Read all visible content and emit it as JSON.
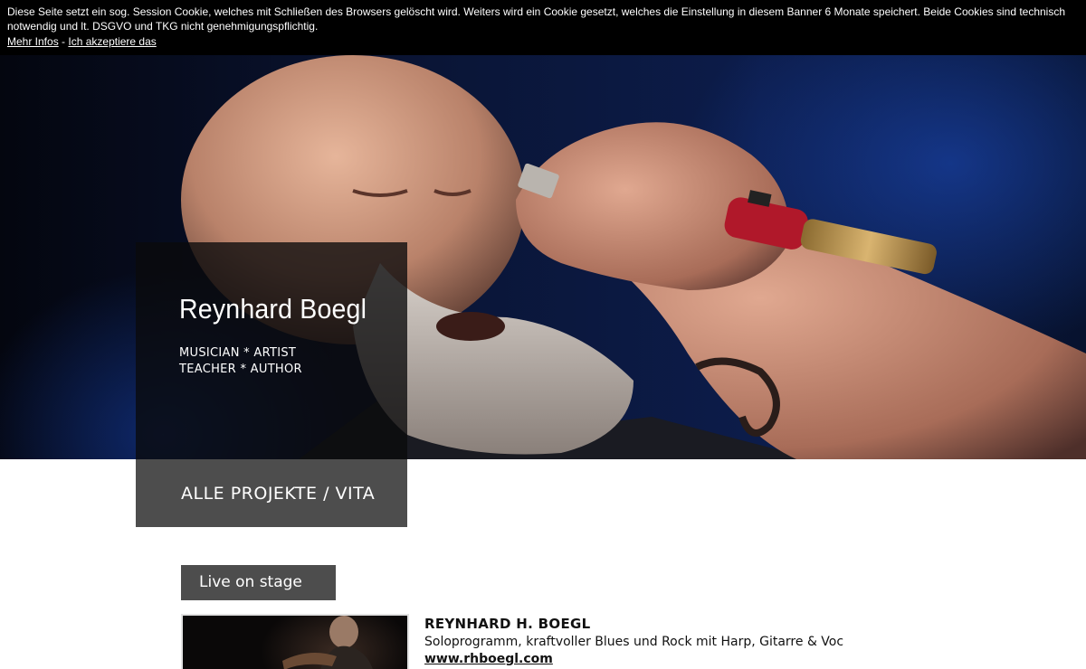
{
  "cookie_banner": {
    "text": "Diese Seite setzt ein sog. Session Cookie, welches mit Schließen des Browsers gelöscht wird. Weiters wird ein Cookie gesetzt, welches die Einstellung in diesem Banner 6 Monate speichert. Beide Cookies sind technisch notwendig und lt. DSGVO und TKG nicht genehmigungspflichtig.",
    "more_info_label": "Mehr Infos",
    "separator": "-",
    "accept_label": "Ich akzeptiere das"
  },
  "hero": {
    "name": "Reynhard Boegl",
    "tagline_line1": "MUSICIAN * ARTIST",
    "tagline_line2": "TEACHER * AUTHOR",
    "projects_button_label": "ALLE PROJEKTE / VITA"
  },
  "section": {
    "live_button_label": "Live on stage"
  },
  "entry": {
    "title": "REYNHARD H. BOEGL",
    "description": "Soloprogramm, kraftvoller Blues und Rock mit Harp, Gitarre & Voc",
    "link_label": "www.rhboegl.com"
  },
  "colors": {
    "banner_bg": "#000000",
    "panel_bg": "#4d4d4d",
    "hero_blue": "#0c1c4a"
  }
}
